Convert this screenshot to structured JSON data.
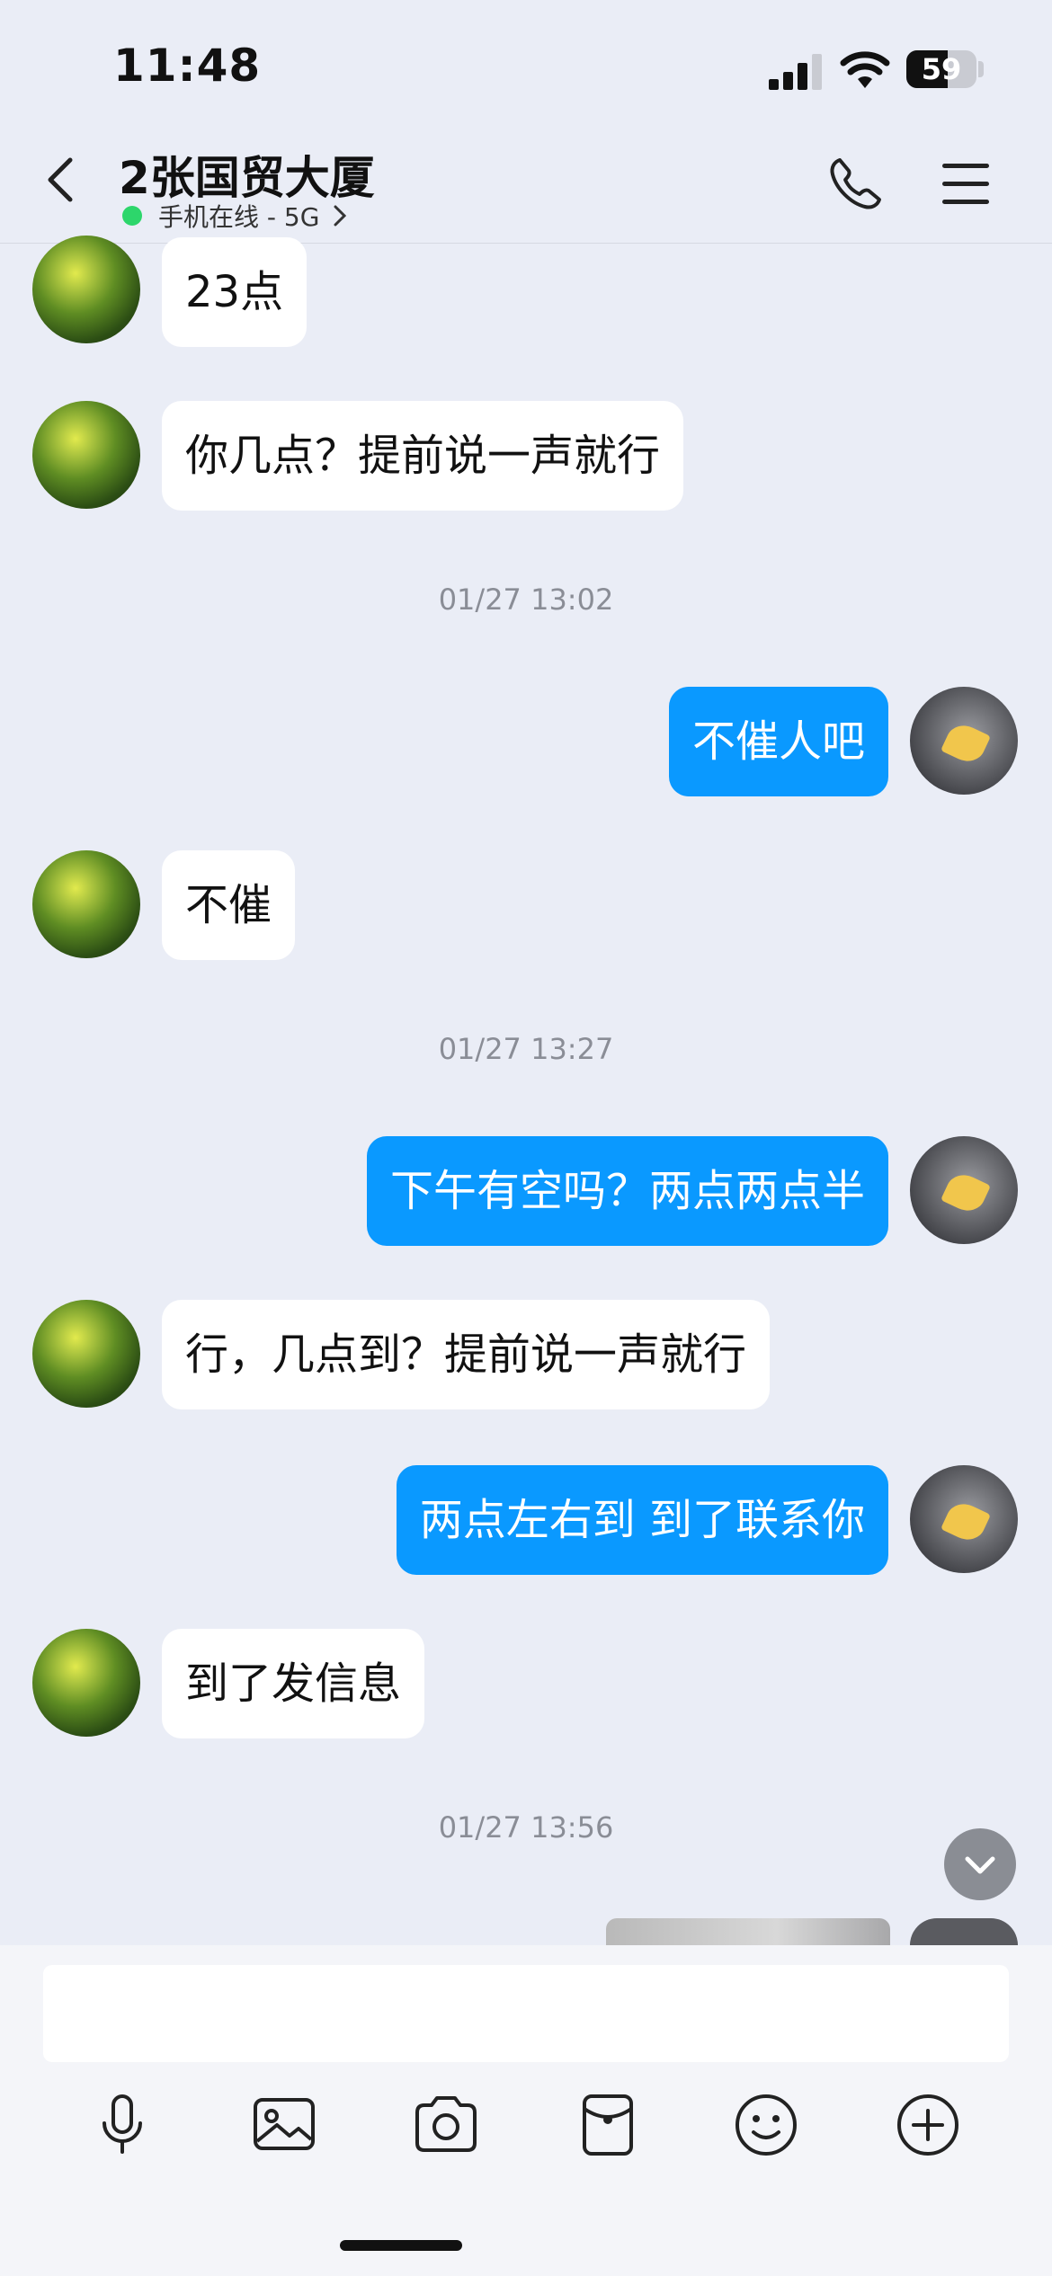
{
  "status": {
    "time": "11:48",
    "battery": "59"
  },
  "header": {
    "title": "2张国贸大厦",
    "presence": "手机在线 - 5G"
  },
  "messages": [
    {
      "text": "23点"
    },
    {
      "text": "你几点？提前说一声就行"
    },
    {
      "time": "01/27 13:02"
    },
    {
      "text": "不催人吧"
    },
    {
      "text": "不催"
    },
    {
      "time": "01/27 13:27"
    },
    {
      "text": "下午有空吗？两点两点半"
    },
    {
      "text": "行，几点到？提前说一声就行"
    },
    {
      "text": "两点左右到 到了联系你"
    },
    {
      "text": "到了发信息"
    },
    {
      "time": "01/27 13:56"
    }
  ],
  "composer": {
    "input_value": ""
  },
  "toolbar": {
    "icons": [
      "microphone-icon",
      "image-icon",
      "camera-icon",
      "red-packet-icon",
      "emoji-icon",
      "plus-icon"
    ]
  }
}
